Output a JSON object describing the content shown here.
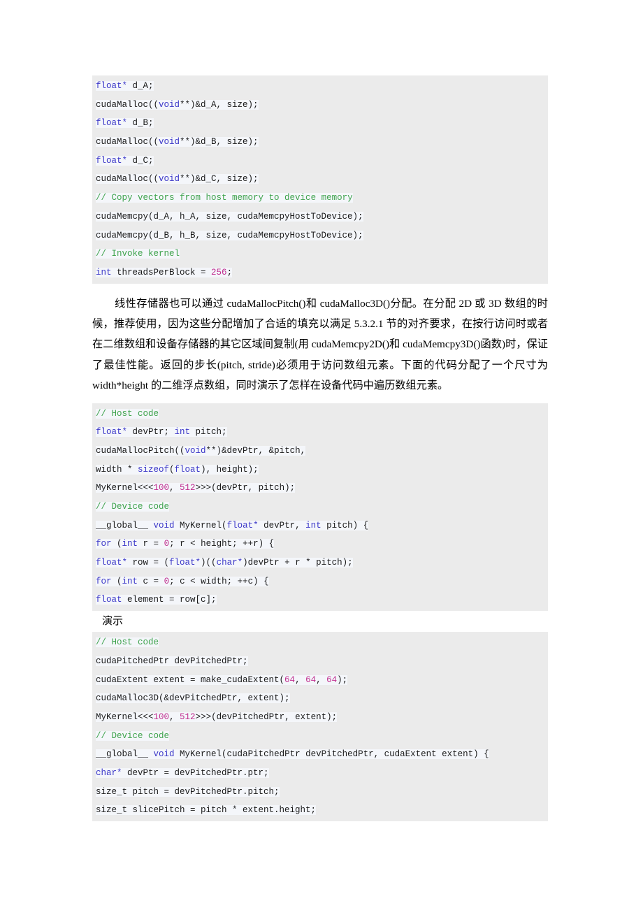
{
  "document": {
    "language": "zh-CN",
    "page_background": "#ffffff",
    "code_block_background": "#ebebeb",
    "keyword_color": "#3b37c8",
    "comment_color": "#3fa34d",
    "number_color": "#c12f8f"
  },
  "code_block_1": {
    "name": "cuda-malloc-memcpy-code",
    "lines": [
      [
        {
          "t": "float*",
          "c": "kw"
        },
        {
          "t": "  d_A;",
          "c": "pl"
        }
      ],
      [
        {
          "t": "cudaMalloc((",
          "c": "pl"
        },
        {
          "t": "void",
          "c": "kw"
        },
        {
          "t": "**)&d_A, size);",
          "c": "pl"
        }
      ],
      [
        {
          "t": "float*",
          "c": "kw"
        },
        {
          "t": "  d_B;",
          "c": "pl"
        }
      ],
      [
        {
          "t": "cudaMalloc((",
          "c": "pl"
        },
        {
          "t": "void",
          "c": "kw"
        },
        {
          "t": "**)&d_B, size);",
          "c": "pl"
        }
      ],
      [
        {
          "t": "float*",
          "c": "kw"
        },
        {
          "t": "  d_C;",
          "c": "pl"
        }
      ],
      [
        {
          "t": "cudaMalloc((",
          "c": "pl"
        },
        {
          "t": "void",
          "c": "kw"
        },
        {
          "t": "**)&d_C, size);",
          "c": "pl"
        }
      ],
      [
        {
          "t": "//",
          "c": "cmt"
        },
        {
          "t": "  Copy vectors from host memory to device memory",
          "c": "cmt"
        }
      ],
      [
        {
          "t": "cudaMemcpy(d_A, h_A, size, cudaMemcpyHostToDevice);",
          "c": "pl"
        }
      ],
      [
        {
          "t": "cudaMemcpy(d_B, h_B, size, cudaMemcpyHostToDevice);",
          "c": "pl"
        }
      ],
      [
        {
          "t": "//",
          "c": "cmt"
        },
        {
          "t": "  Invoke kernel",
          "c": "cmt"
        }
      ],
      [
        {
          "t": "int",
          "c": "kw"
        },
        {
          "t": "  threadsPerBlock  =  ",
          "c": "pl"
        },
        {
          "t": "256",
          "c": "num"
        },
        {
          "t": ";",
          "c": "pl"
        }
      ]
    ]
  },
  "paragraph_1": {
    "name": "linear-memory-paragraph",
    "text": "线性存储器也可以通过 cudaMallocPitch()和 cudaMalloc3D()分配。在分配 2D 或 3D 数组的时候，推荐使用，因为这些分配增加了合适的填充以满足 5.3.2.1 节的对齐要求，在按行访问时或者在二维数组和设备存储器的其它区域间复制(用 cudaMemcpy2D()和 cudaMemcpy3D()函数)时，保证了最佳性能。返回的步长(pitch, stride)必须用于访问数组元素。下面的代码分配了一个尺寸为 width*height 的二维浮点数组，同时演示了怎样在设备代码中遍历数组元素。"
  },
  "code_block_2": {
    "name": "cuda-malloc-pitch-code",
    "lines": [
      [
        {
          "t": "//",
          "c": "cmt"
        },
        {
          "t": "  Host code",
          "c": "cmt"
        }
      ],
      [
        {
          "t": "float*",
          "c": "kw"
        },
        {
          "t": "  devPtr;  ",
          "c": "pl"
        },
        {
          "t": "int",
          "c": "kw"
        },
        {
          "t": "  pitch;",
          "c": "pl"
        }
      ],
      [
        {
          "t": "cudaMallocPitch((",
          "c": "pl"
        },
        {
          "t": "void",
          "c": "kw"
        },
        {
          "t": "**)&devPtr,  &pitch,",
          "c": "pl"
        }
      ],
      [
        {
          "t": "width  *  ",
          "c": "pl"
        },
        {
          "t": "sizeof",
          "c": "kw"
        },
        {
          "t": "(",
          "c": "pl"
        },
        {
          "t": "float",
          "c": "kw"
        },
        {
          "t": "), height);",
          "c": "pl"
        }
      ],
      [
        {
          "t": "MyKernel<<<",
          "c": "pl"
        },
        {
          "t": "100",
          "c": "num"
        },
        {
          "t": ",  ",
          "c": "pl"
        },
        {
          "t": "512",
          "c": "num"
        },
        {
          "t": ">>>(devPtr, pitch);",
          "c": "pl"
        }
      ],
      [
        {
          "t": "//",
          "c": "cmt"
        },
        {
          "t": "  Device code",
          "c": "cmt"
        }
      ],
      [
        {
          "t": "__global__",
          "c": "pl"
        },
        {
          "t": "  ",
          "c": "pl"
        },
        {
          "t": "void",
          "c": "kw"
        },
        {
          "t": "  MyKernel(",
          "c": "pl"
        },
        {
          "t": "float*",
          "c": "kw"
        },
        {
          "t": "  devPtr,  ",
          "c": "pl"
        },
        {
          "t": "int",
          "c": "kw"
        },
        {
          "t": "  pitch) {",
          "c": "pl"
        }
      ],
      [
        {
          "t": "for",
          "c": "kw"
        },
        {
          "t": "  (",
          "c": "pl"
        },
        {
          "t": "int",
          "c": "kw"
        },
        {
          "t": "  r  =  ",
          "c": "pl"
        },
        {
          "t": "0",
          "c": "num"
        },
        {
          "t": "; r  <  height;  ++r) {",
          "c": "pl"
        }
      ],
      [
        {
          "t": "float*",
          "c": "kw"
        },
        {
          "t": "  row  =  (",
          "c": "pl"
        },
        {
          "t": "float*",
          "c": "kw"
        },
        {
          "t": ")((",
          "c": "pl"
        },
        {
          "t": "char*",
          "c": "kw"
        },
        {
          "t": ")devPtr  +  r  *  pitch);",
          "c": "pl"
        }
      ],
      [
        {
          "t": "for",
          "c": "kw"
        },
        {
          "t": "  (",
          "c": "pl"
        },
        {
          "t": "int",
          "c": "kw"
        },
        {
          "t": "  c  =  ",
          "c": "pl"
        },
        {
          "t": "0",
          "c": "num"
        },
        {
          "t": "; c  <  width;  ++c) {",
          "c": "pl"
        }
      ],
      [
        {
          "t": "float",
          "c": "kw"
        },
        {
          "t": "  element  =  row[c];",
          "c": "pl"
        }
      ]
    ]
  },
  "caption_1": {
    "name": "demo-caption",
    "text": "演示"
  },
  "code_block_3": {
    "name": "cuda-malloc-3d-code",
    "lines": [
      [
        {
          "t": "//",
          "c": "cmt"
        },
        {
          "t": "  Host code",
          "c": "cmt"
        }
      ],
      [
        {
          "t": "cudaPitchedPtr devPitchedPtr;",
          "c": "pl"
        }
      ],
      [
        {
          "t": "cudaExtent extent  =  make_cudaExtent(",
          "c": "pl"
        },
        {
          "t": "64",
          "c": "num"
        },
        {
          "t": ",  ",
          "c": "pl"
        },
        {
          "t": "64",
          "c": "num"
        },
        {
          "t": ",  ",
          "c": "pl"
        },
        {
          "t": "64",
          "c": "num"
        },
        {
          "t": ");",
          "c": "pl"
        }
      ],
      [
        {
          "t": "cudaMalloc3D(&devPitchedPtr, extent);",
          "c": "pl"
        }
      ],
      [
        {
          "t": "MyKernel<<<",
          "c": "pl"
        },
        {
          "t": "100",
          "c": "num"
        },
        {
          "t": ",  ",
          "c": "pl"
        },
        {
          "t": "512",
          "c": "num"
        },
        {
          "t": ">>>(devPitchedPtr, extent);",
          "c": "pl"
        }
      ],
      [
        {
          "t": "//",
          "c": "cmt"
        },
        {
          "t": "  Device code",
          "c": "cmt"
        }
      ],
      [
        {
          "t": "__global__",
          "c": "pl"
        },
        {
          "t": "  ",
          "c": "pl"
        },
        {
          "t": "void",
          "c": "kw"
        },
        {
          "t": "  MyKernel(cudaPitchedPtr devPitchedPtr, cudaExtent extent) {",
          "c": "pl"
        }
      ],
      [
        {
          "t": "char*",
          "c": "kw"
        },
        {
          "t": "  devPtr  =  devPitchedPtr.ptr;",
          "c": "pl"
        }
      ],
      [
        {
          "t": "size_t pitch  =  devPitchedPtr.pitch;",
          "c": "pl"
        }
      ],
      [
        {
          "t": "size_t slicePitch  =  pitch  *  extent.height;",
          "c": "pl"
        }
      ]
    ]
  }
}
